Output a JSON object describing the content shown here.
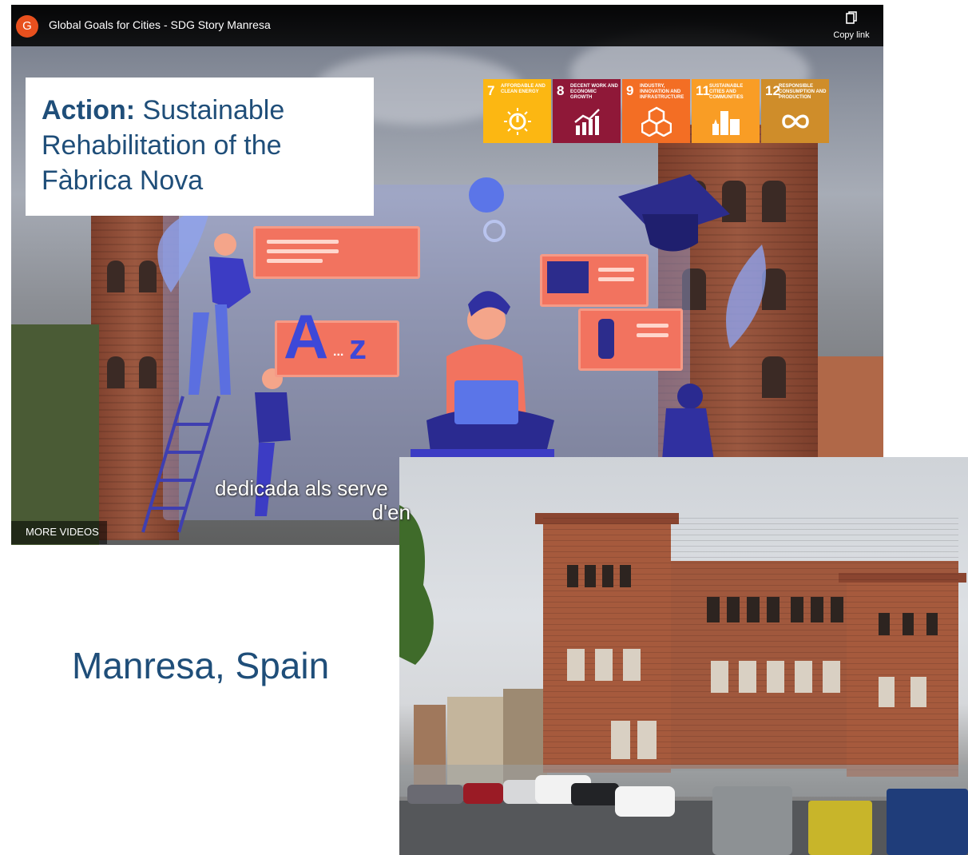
{
  "video": {
    "channel_initial": "G",
    "title": "Global Goals for Cities - SDG Story Manresa",
    "copy_link_label": "Copy link",
    "more_videos_label": "MORE VIDEOS",
    "subtitle_line1": "dedicada als serve",
    "subtitle_line2": "d'en"
  },
  "action": {
    "label": "Action:",
    "text": "Sustainable Rehabilitation of the Fàbrica Nova"
  },
  "sdg_goals": [
    {
      "number": "7",
      "text": "AFFORDABLE AND CLEAN ENERGY",
      "color": "#fcb712",
      "icon": "sun-power-icon"
    },
    {
      "number": "8",
      "text": "DECENT WORK AND ECONOMIC GROWTH",
      "color": "#8f1838",
      "icon": "growth-chart-icon"
    },
    {
      "number": "9",
      "text": "INDUSTRY, INNOVATION AND INFRASTRUCTURE",
      "color": "#f36e24",
      "icon": "cubes-icon"
    },
    {
      "number": "11",
      "text": "SUSTAINABLE CITIES AND COMMUNITIES",
      "color": "#f99d25",
      "icon": "buildings-icon"
    },
    {
      "number": "12",
      "text": "RESPONSIBLE CONSUMPTION AND PRODUCTION",
      "color": "#cf8d2a",
      "icon": "infinity-icon"
    }
  ],
  "illustration_letters": {
    "big": "A",
    "dots": "...",
    "small": "z"
  },
  "location": "Manresa, Spain"
}
